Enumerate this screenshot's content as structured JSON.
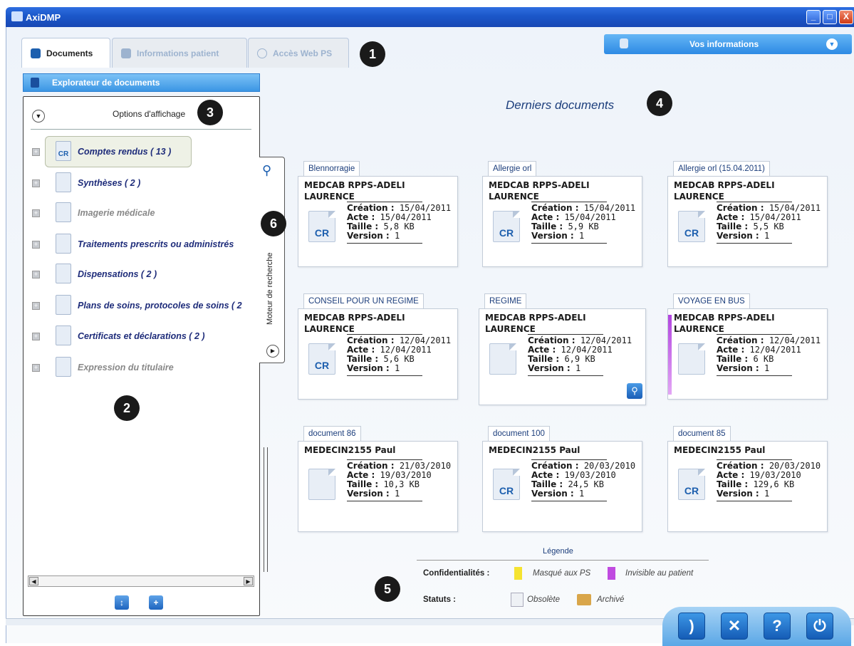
{
  "window": {
    "title": "AxiDMP",
    "min": "_",
    "max": "□",
    "close": "X"
  },
  "tabs": [
    {
      "label": "Documents"
    },
    {
      "label": "Informations patient"
    },
    {
      "label": "Accès Web PS"
    }
  ],
  "user_panel": {
    "label": "Vos informations"
  },
  "callouts": [
    "1",
    "2",
    "3",
    "4",
    "5",
    "6"
  ],
  "explorer": {
    "header": "Explorateur de documents",
    "options_label": "Options d'affichage",
    "items": [
      {
        "label": "Comptes rendus ( 13 )",
        "icon": "cr-document-icon",
        "enabled": true,
        "selected": true
      },
      {
        "label": "Synthèses ( 2 )",
        "icon": "synthesis-document-icon",
        "enabled": true
      },
      {
        "label": "Imagerie médicale",
        "icon": "radiation-icon",
        "enabled": false
      },
      {
        "label": "Traitements prescrits ou administrés",
        "icon": "syringe-icon",
        "enabled": true
      },
      {
        "label": "Dispensations ( 2 )",
        "icon": "pills-icon",
        "enabled": true
      },
      {
        "label": "Plans de soins, protocoles de soins ( 2",
        "icon": "care-plan-icon",
        "enabled": true
      },
      {
        "label": "Certificats et déclarations ( 2 )",
        "icon": "speech-bubble-icon",
        "enabled": true
      },
      {
        "label": "Expression du titulaire",
        "icon": "person-icon",
        "enabled": false
      }
    ]
  },
  "search_panel": {
    "label": "Moteur de recherche"
  },
  "main": {
    "title": "Derniers documents",
    "cards": [
      {
        "tab": "Blennorragie",
        "author": "MEDCAB RPPS-ADELI LAURENCE",
        "creation": "15/04/2011",
        "acte": "15/04/2011",
        "taille": "5,8 KB",
        "version": "1",
        "icon": "CR"
      },
      {
        "tab": "Allergie orl",
        "author": "MEDCAB RPPS-ADELI LAURENCE",
        "creation": "15/04/2011",
        "acte": "15/04/2011",
        "taille": "5,9 KB",
        "version": "1",
        "icon": "CR"
      },
      {
        "tab": "Allergie orl  (15.04.2011)",
        "author": "MEDCAB RPPS-ADELI LAURENCE",
        "creation": "15/04/2011",
        "acte": "15/04/2011",
        "taille": "5,5 KB",
        "version": "1",
        "icon": "CR"
      },
      {
        "tab": "CONSEIL POUR UN REGIME",
        "author": "MEDCAB RPPS-ADELI LAURENCE",
        "creation": "12/04/2011",
        "acte": "12/04/2011",
        "taille": "5,6 KB",
        "version": "1",
        "icon": "CR"
      },
      {
        "tab": "REGIME",
        "author": "MEDCAB RPPS-ADELI LAURENCE",
        "creation": "12/04/2011",
        "acte": "12/04/2011",
        "taille": "6,9 KB",
        "version": "1",
        "icon": "syringe"
      },
      {
        "tab": "VOYAGE EN BUS",
        "author": "MEDCAB RPPS-ADELI LAURENCE",
        "creation": "12/04/2011",
        "acte": "12/04/2011",
        "taille": "6 KB",
        "version": "1",
        "icon": "bubble"
      },
      {
        "tab": "document 86",
        "author": "MEDECIN2155 Paul",
        "creation": "21/03/2010",
        "acte": "19/03/2010",
        "taille": "10,3 KB",
        "version": "1",
        "icon": "text"
      },
      {
        "tab": "document 100",
        "author": "MEDECIN2155 Paul",
        "creation": "20/03/2010",
        "acte": "19/03/2010",
        "taille": "24,5 KB",
        "version": "1",
        "icon": "CR"
      },
      {
        "tab": "document 85",
        "author": "MEDECIN2155 Paul",
        "creation": "20/03/2010",
        "acte": "19/03/2010",
        "taille": "129,6 KB",
        "version": "1",
        "icon": "CR"
      }
    ],
    "field_labels": {
      "creation": "Création :",
      "acte": "Acte :",
      "taille": "Taille :",
      "version": "Version :"
    },
    "cr_text": "CR"
  },
  "legend": {
    "title": "Légende",
    "confidentialites_label": "Confidentialités :",
    "masque_label": "Masqué aux PS",
    "invisible_label": "Invisible au patient",
    "statuts_label": "Statuts :",
    "obsolete_label": "Obsolète",
    "archive_label": "Archivé",
    "colors": {
      "masque": "#f5e330",
      "invisible": "#c04ae0"
    }
  },
  "toolbar": {
    "buttons": [
      "rss",
      "tools",
      "help",
      "power"
    ],
    "help_glyph": "?"
  }
}
